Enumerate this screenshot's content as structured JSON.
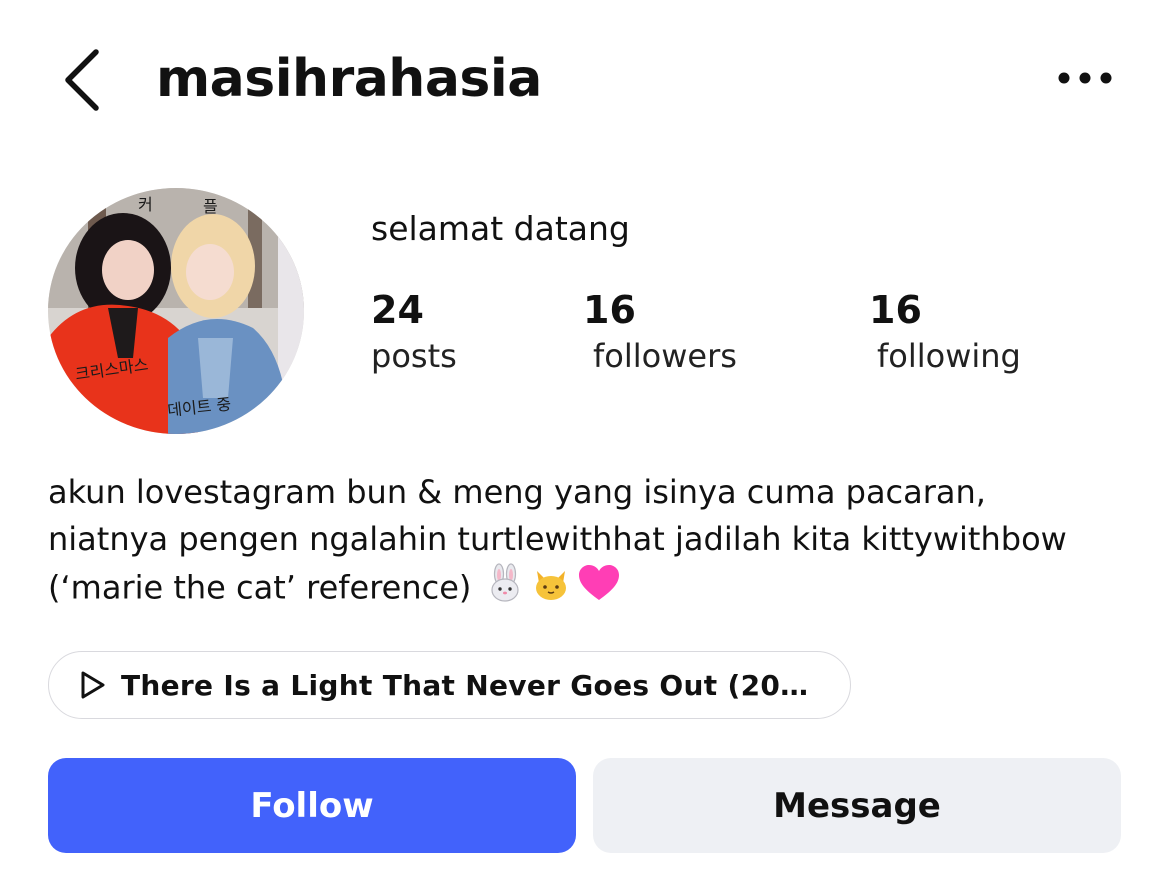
{
  "header": {
    "username": "masihrahasia",
    "back_icon": "chevron-left-icon",
    "more_icon": "ellipsis-horizontal-icon"
  },
  "profile": {
    "display_name": "selamat datang",
    "stats": [
      {
        "value": "24",
        "label": "posts"
      },
      {
        "value": "16",
        "label": "followers"
      },
      {
        "value": "16",
        "label": "following"
      }
    ],
    "bio": [
      "akun lovestagram bun & meng yang isinya cuma pacaran,",
      "niatnya pengen ngalahin turtlewithhat jadilah kita kittywithbow",
      "(‘marie the cat’ reference)"
    ],
    "bio_emojis": [
      "rabbit-face",
      "cat-face",
      "pink-heart"
    ]
  },
  "music": {
    "icon": "play-icon",
    "title": "There Is a Light That Never Goes Out (2017..."
  },
  "actions": {
    "follow_label": "Follow",
    "message_label": "Message"
  },
  "colors": {
    "follow_bg": "#4262fb",
    "message_bg": "#eef0f4",
    "text": "#111111",
    "heart": "#ff3eb5"
  }
}
